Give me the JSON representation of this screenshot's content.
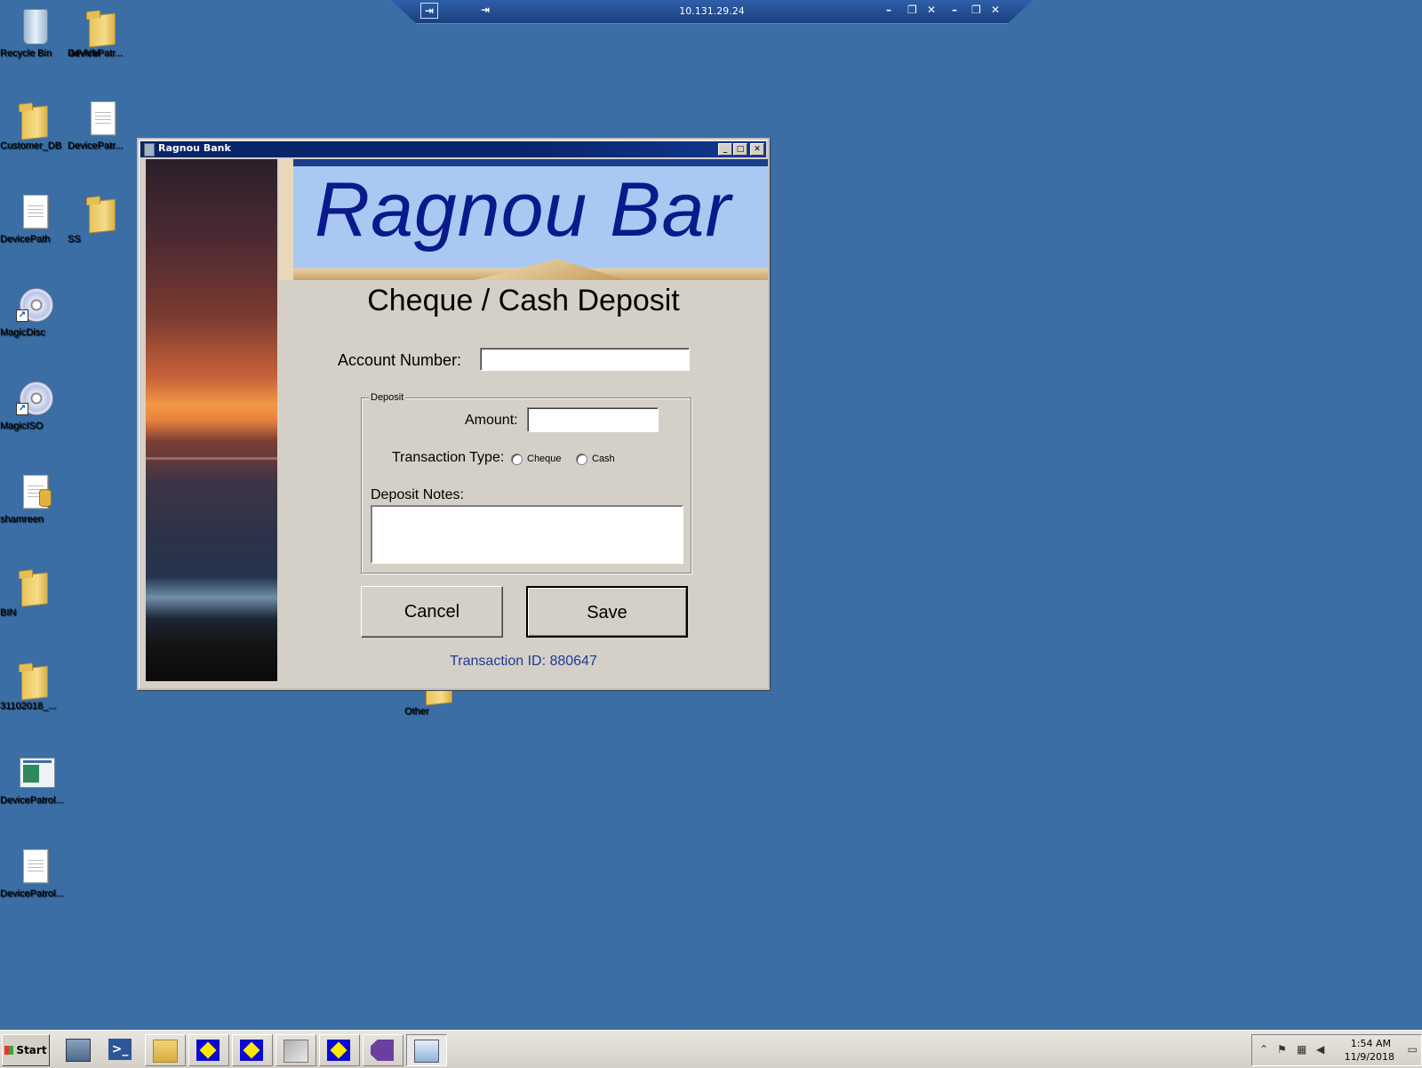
{
  "desktop": {
    "icons": [
      {
        "label": "Recycle Bin",
        "type": "recycle-bin"
      },
      {
        "label": "DevicePatr...",
        "label2": "-MVVM",
        "type": "folder"
      },
      {
        "label": "Customer_DB",
        "type": "folder"
      },
      {
        "label": "DevicePatr...",
        "type": "document"
      },
      {
        "label": "DevicePath",
        "type": "document"
      },
      {
        "label": "SS",
        "type": "folder"
      },
      {
        "label": "MagicDisc",
        "type": "disc-shortcut"
      },
      {
        "label": "MagicISO",
        "type": "disc-shortcut"
      },
      {
        "label": "shamreen",
        "type": "database-file"
      },
      {
        "label": "BIN",
        "type": "folder"
      },
      {
        "label": "31102018_...",
        "type": "folder"
      },
      {
        "label": "DevicePatrol...",
        "type": "application"
      },
      {
        "label": "DevicePatrol...",
        "type": "document"
      },
      {
        "label": "Other",
        "type": "folder"
      }
    ]
  },
  "rdp": {
    "host": "10.131.29.24",
    "pin_icon": "pin-icon",
    "controls": [
      "minimize",
      "restore",
      "close"
    ]
  },
  "window": {
    "title": "Ragnou Bank",
    "controls": {
      "minimize": "_",
      "maximize": "□",
      "close": "✕"
    }
  },
  "banner": {
    "bank_name": "Ragnou Bar"
  },
  "form": {
    "title": "Cheque / Cash Deposit",
    "account_label": "Account Number:",
    "account_value": "",
    "deposit_group": "Deposit",
    "amount_label": "Amount:",
    "amount_value": "",
    "transaction_type_label": "Transaction Type:",
    "transaction_types": [
      "Cheque",
      "Cash"
    ],
    "selected_type": null,
    "notes_label": "Deposit Notes:",
    "notes_value": "",
    "cancel_label": "Cancel",
    "save_label": "Save",
    "transaction_id": "Transaction ID:  880647"
  },
  "taskbar": {
    "start_label": "Start",
    "apps": [
      "server-manager",
      "powershell",
      "file-explorer",
      "diamond-app",
      "diamond-app",
      "tools-app",
      "diamond-app",
      "visual-studio",
      "ragnou-bank"
    ],
    "active_app": "ragnou-bank",
    "clock_time": "1:54 AM",
    "clock_date": "11/9/2018"
  }
}
